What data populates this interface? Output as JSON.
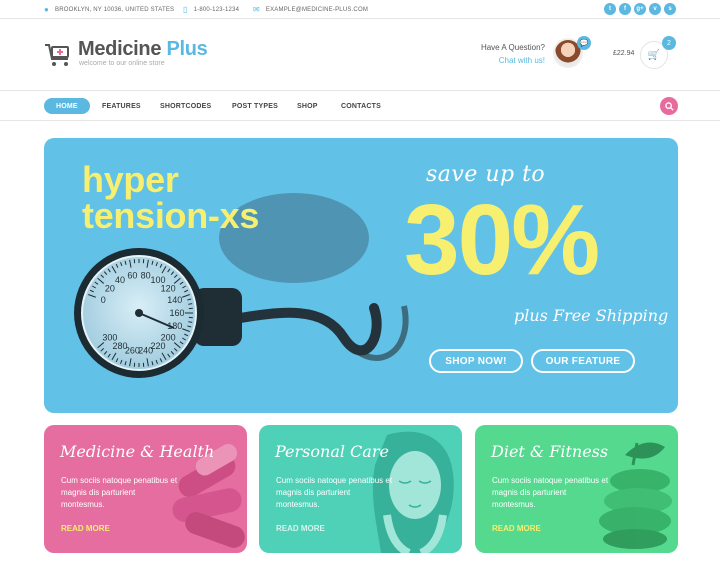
{
  "topbar": {
    "address": "BROOKLYN, NY 10036, UNITED STATES",
    "phone": "1-800-123-1234",
    "email": "EXAMPLE@MEDICINE-PLUS.COM",
    "socials": [
      "t",
      "f",
      "g+",
      "v",
      "s"
    ]
  },
  "logo": {
    "name_part1": "Medicine",
    "name_part2": "Plus",
    "tagline": "welcome to our online store"
  },
  "contact": {
    "question": "Have A Question?",
    "chat": "Chat with us!"
  },
  "cart": {
    "price": "£22.94",
    "count": "2"
  },
  "nav": {
    "items": [
      "HOME",
      "FEATURES",
      "SHORTCODES",
      "POST TYPES",
      "SHOP",
      "CONTACTS"
    ]
  },
  "hero": {
    "title_line1": "hyper",
    "title_line2": "tension-xs",
    "save": "save up to",
    "percent": "30%",
    "shipping": "plus Free Shipping",
    "btn_shop": "SHOP NOW!",
    "btn_feature": "OUR FEATURE",
    "gauge_labels": [
      "0",
      "20",
      "40",
      "60",
      "80",
      "100",
      "120",
      "140",
      "160",
      "180",
      "200",
      "220",
      "240",
      "260",
      "280",
      "300"
    ]
  },
  "cards": [
    {
      "title": "Medicine & Health",
      "text": "Cum sociis natoque penatibus et magnis dis parturient montesmus.",
      "more": "READ MORE"
    },
    {
      "title": "Personal Care",
      "text": "Cum sociis natoque penatibus et magnis dis parturient montesmus.",
      "more": "READ MORE"
    },
    {
      "title": "Diet & Fitness",
      "text": "Cum sociis natoque penatibus et magnis dis parturient montesmus.",
      "more": "READ MORE"
    }
  ],
  "colors": {
    "accent_blue": "#5bb8e0",
    "hero_bg": "#62c1e6",
    "yellow": "#f6ef70",
    "pink": "#e56d9f",
    "teal": "#4fd1b8",
    "green": "#54d98f"
  }
}
